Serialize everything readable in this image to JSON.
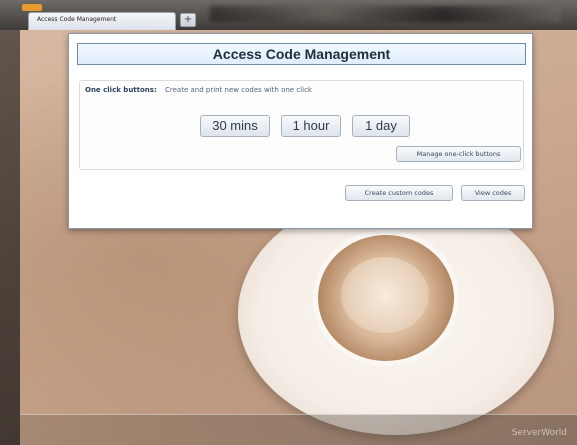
{
  "browser": {
    "tab_title": "Access Code Management",
    "new_tab_symbol": "+"
  },
  "dialog": {
    "title": "Access Code Management",
    "one_click": {
      "label": "One click buttons:",
      "description": "Create and print new codes with one click",
      "buttons": [
        "30 mins",
        "1 hour",
        "1 day"
      ],
      "manage_label": "Manage one-click buttons"
    },
    "create_custom_label": "Create custom codes",
    "view_codes_label": "View codes"
  },
  "footer": {
    "watermark": "ServerWorld"
  },
  "colors": {
    "header_border": "#6f8aa8",
    "accent_text": "#2b4460",
    "background": "#cfae95"
  }
}
